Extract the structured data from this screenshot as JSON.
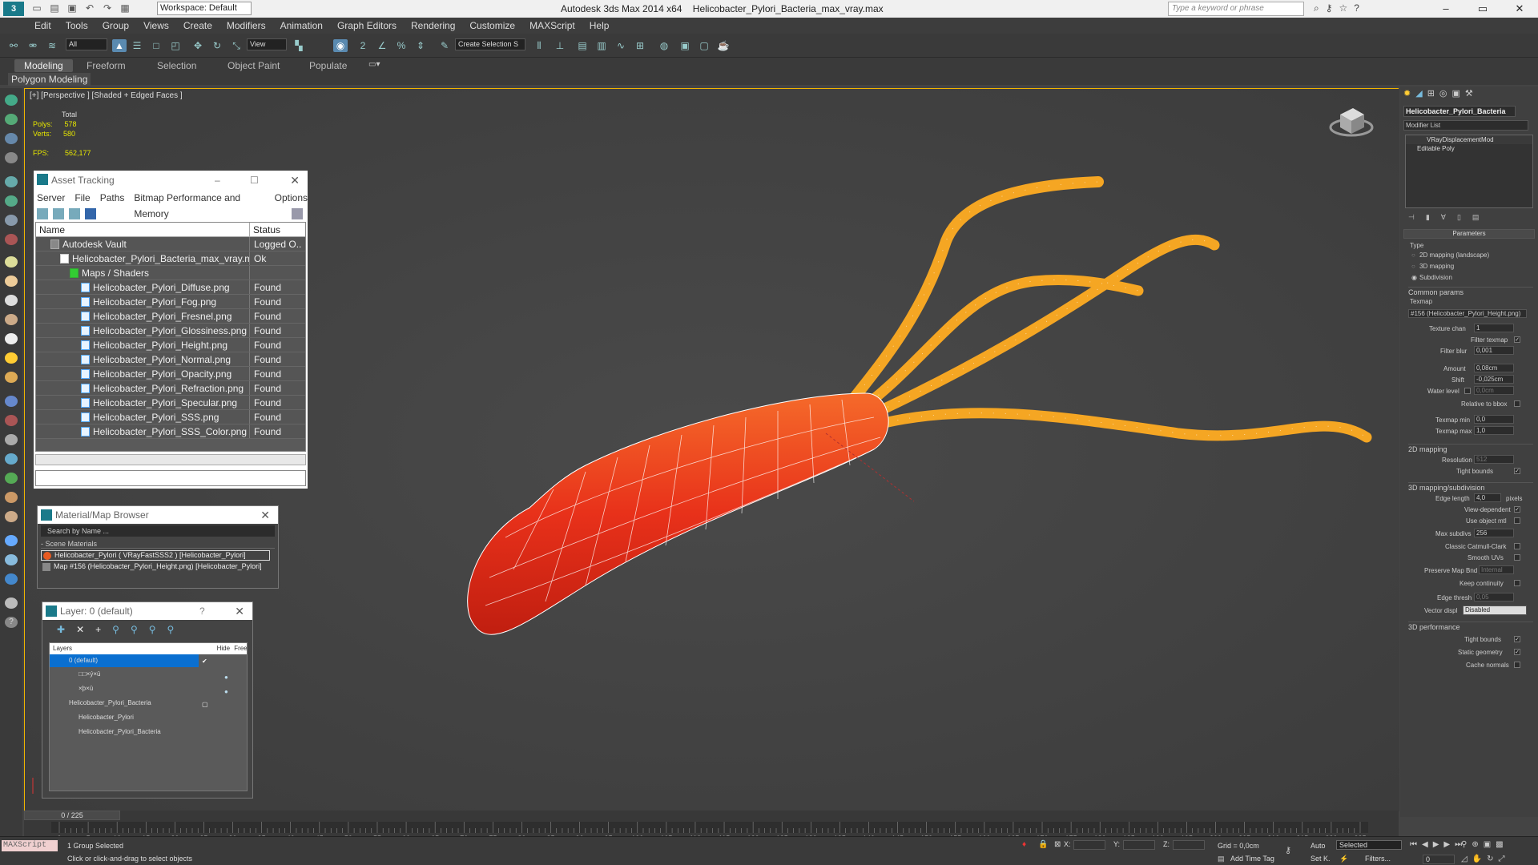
{
  "titlebar": {
    "workspace": "Workspace: Default",
    "app": "Autodesk 3ds Max  2014 x64",
    "file": "Helicobacter_Pylori_Bacteria_max_vray.max",
    "search_placeholder": "Type a keyword or phrase"
  },
  "menu": [
    "Edit",
    "Tools",
    "Group",
    "Views",
    "Create",
    "Modifiers",
    "Animation",
    "Graph Editors",
    "Rendering",
    "Customize",
    "MAXScript",
    "Help"
  ],
  "toolbar": {
    "filter": "All",
    "refcoord": "View",
    "selset": "Create Selection S"
  },
  "ribbon": {
    "tabs": [
      "Modeling",
      "Freeform",
      "Selection",
      "Object Paint",
      "Populate"
    ],
    "sub": "Polygon Modeling"
  },
  "viewport": {
    "label": "[+] [Perspective ] [Shaded + Edged Faces ]",
    "stats": {
      "total": "Total",
      "polys_label": "Polys:",
      "polys": "578",
      "verts_label": "Verts:",
      "verts": "580",
      "fps_label": "FPS:",
      "fps": "562,177"
    },
    "colors": {
      "body": "#e8311a",
      "flagella": "#f5a623",
      "wire": "#ffffff"
    }
  },
  "asset_tracking": {
    "title": "Asset Tracking",
    "menu": [
      "Server",
      "File",
      "Paths",
      "Bitmap Performance and Memory",
      "Options"
    ],
    "col_name": "Name",
    "col_status": "Status",
    "rows": [
      {
        "name": "Autodesk Vault",
        "status": "Logged O..."
      },
      {
        "name": "Helicobacter_Pylori_Bacteria_max_vray.max",
        "status": "Ok"
      },
      {
        "name": "Maps / Shaders",
        "status": ""
      },
      {
        "name": "Helicobacter_Pylori_Diffuse.png",
        "status": "Found"
      },
      {
        "name": "Helicobacter_Pylori_Fog.png",
        "status": "Found"
      },
      {
        "name": "Helicobacter_Pylori_Fresnel.png",
        "status": "Found"
      },
      {
        "name": "Helicobacter_Pylori_Glossiness.png",
        "status": "Found"
      },
      {
        "name": "Helicobacter_Pylori_Height.png",
        "status": "Found"
      },
      {
        "name": "Helicobacter_Pylori_Normal.png",
        "status": "Found"
      },
      {
        "name": "Helicobacter_Pylori_Opacity.png",
        "status": "Found"
      },
      {
        "name": "Helicobacter_Pylori_Refraction.png",
        "status": "Found"
      },
      {
        "name": "Helicobacter_Pylori_Specular.png",
        "status": "Found"
      },
      {
        "name": "Helicobacter_Pylori_SSS.png",
        "status": "Found"
      },
      {
        "name": "Helicobacter_Pylori_SSS_Color.png",
        "status": "Found"
      }
    ]
  },
  "material_browser": {
    "title": "Material/Map Browser",
    "search": "Search by Name ...",
    "section": "- Scene Materials",
    "items": [
      "Helicobacter_Pylori ( VRayFastSSS2 ) [Helicobacter_Pylori]",
      "Map #156 (Helicobacter_Pylori_Height.png) [Helicobacter_Pylori]"
    ]
  },
  "layer": {
    "title": "Layer: 0 (default)",
    "col_layers": "Layers",
    "col_hide": "Hide",
    "col_freeze": "Free",
    "rows": [
      "0 (default)",
      "□□×ý×ū",
      "×þ×ū",
      "Helicobacter_Pylori_Bacteria",
      "Helicobacter_Pylori",
      "Helicobacter_Pylori_Bacteria"
    ]
  },
  "command_panel": {
    "object_name": "Helicobacter_Pylori_Bacteria",
    "modifier_list": "Modifier List",
    "stack": [
      "VRayDisplacementMod",
      "Editable Poly"
    ],
    "rollout": "Parameters",
    "type_label": "Type",
    "types": [
      "2D mapping (landscape)",
      "3D mapping",
      "Subdivision"
    ],
    "common": "Common params",
    "texmap_label": "Texmap",
    "texmap": "#156 (Helicobacter_Pylori_Height.png)",
    "texture_chan": "Texture chan",
    "texture_chan_v": "1",
    "filter_texmap": "Filter texmap",
    "filter_blur": "Filter blur",
    "filter_blur_v": "0,001",
    "amount": "Amount",
    "amount_v": "0,08cm",
    "shift": "Shift",
    "shift_v": "-0,025cm",
    "water": "Water level",
    "water_v": "0,0cm",
    "rel_bbox": "Relative to bbox",
    "texmap_min": "Texmap min",
    "texmap_min_v": "0,0",
    "texmap_max": "Texmap max",
    "texmap_max_v": "1,0",
    "mapping2d": "2D mapping",
    "resolution": "Resolution",
    "resolution_v": "512",
    "tight": "Tight bounds",
    "mapping3d": "3D mapping/subdivision",
    "edge_len": "Edge length",
    "edge_len_v": "4,0",
    "pixels": "pixels",
    "view_dep": "View-dependent",
    "use_obj": "Use object mtl",
    "max_sub": "Max subdivs",
    "max_sub_v": "256",
    "catmull": "Classic Catmull-Clark",
    "smooth_uv": "Smooth UVs",
    "preserve": "Preserve Map Bnd",
    "preserve_v": "Internal",
    "keep_cont": "Keep continuity",
    "edge_thresh": "Edge thresh",
    "edge_thresh_v": "0,05",
    "vector_disp": "Vector displ",
    "vector_disp_v": "Disabled",
    "perf": "3D performance",
    "tight2": "Tight bounds",
    "static_geo": "Static geometry",
    "cache": "Cache normals"
  },
  "timeline": {
    "frame": "0 / 225",
    "ticks": [
      0,
      5,
      10,
      15,
      20,
      25,
      30,
      35,
      40,
      45,
      50,
      55,
      60,
      65,
      70,
      75,
      80,
      85,
      90,
      95,
      100,
      105,
      110,
      115,
      120,
      125,
      130,
      135,
      140,
      145,
      150,
      155,
      160,
      165,
      170,
      175,
      180,
      185,
      190,
      195,
      200,
      205,
      210,
      215,
      220,
      225
    ]
  },
  "status": {
    "maxscript": "MAXScript",
    "selected": "1 Group Selected",
    "hint": "Click or click-and-drag to select objects",
    "x": "X:",
    "y": "Y:",
    "z": "Z:",
    "grid": "Grid = 0,0cm",
    "auto": "Auto",
    "setk": "Set K.",
    "sel_mode": "Selected",
    "add_time_tag": "Add Time Tag",
    "filters": "Filters...",
    "frame_field": "0"
  }
}
